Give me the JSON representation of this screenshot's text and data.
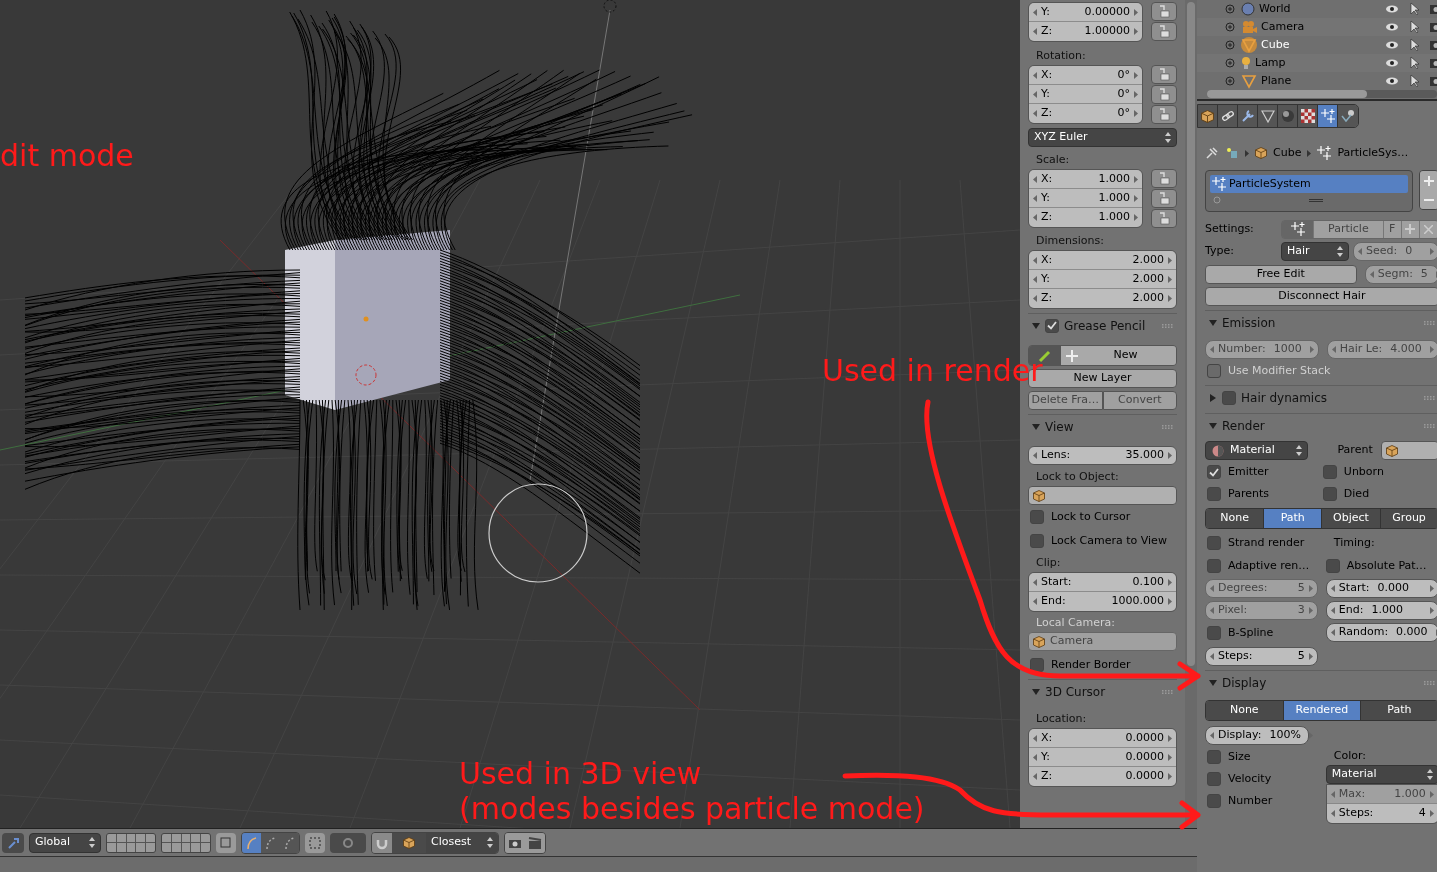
{
  "viewport": {
    "edit_mode_note": "dit mode",
    "render_note": "Used in render",
    "view_note": [
      "Used in 3D view",
      "(modes besides particle mode)"
    ]
  },
  "n_panel": {
    "location": [
      {
        "label": "Y:",
        "value": "0.00000"
      },
      {
        "label": "Z:",
        "value": "1.00000"
      }
    ],
    "rotation": {
      "label": "Rotation:",
      "fields": [
        {
          "label": "X:",
          "value": "0°"
        },
        {
          "label": "Y:",
          "value": "0°"
        },
        {
          "label": "Z:",
          "value": "0°"
        }
      ],
      "mode": "XYZ Euler"
    },
    "scale": {
      "label": "Scale:",
      "fields": [
        {
          "label": "X:",
          "value": "1.000"
        },
        {
          "label": "Y:",
          "value": "1.000"
        },
        {
          "label": "Z:",
          "value": "1.000"
        }
      ]
    },
    "dimensions": {
      "label": "Dimensions:",
      "fields": [
        {
          "label": "X:",
          "value": "2.000"
        },
        {
          "label": "Y:",
          "value": "2.000"
        },
        {
          "label": "Z:",
          "value": "2.000"
        }
      ]
    },
    "grease_pencil": {
      "title": "Grease Pencil",
      "expanded": true,
      "enabled": true,
      "new": "New",
      "new_layer": "New Layer",
      "delete_frame": "Delete Fra…",
      "convert": "Convert"
    },
    "view": {
      "title": "View",
      "expanded": true,
      "lens": {
        "label": "Lens:",
        "value": "35.000"
      },
      "lock_label": "Lock to Object:",
      "locks": [
        {
          "label": "Lock to Cursor",
          "checked": false
        },
        {
          "label": "Lock Camera to View",
          "checked": false
        }
      ],
      "clip_label": "Clip:",
      "clip": [
        {
          "label": "Start:",
          "value": "0.100"
        },
        {
          "label": "End:",
          "value": "1000.000"
        }
      ],
      "local_camera_label": "Local Camera:",
      "local_camera": "Camera",
      "render_border": {
        "label": "Render Border",
        "checked": false
      }
    },
    "cursor": {
      "title": "3D Cursor",
      "expanded": true,
      "location_label": "Location:",
      "fields": [
        {
          "label": "X:",
          "value": "0.0000"
        },
        {
          "label": "Y:",
          "value": "0.0000"
        },
        {
          "label": "Z:",
          "value": "0.0000"
        }
      ]
    }
  },
  "toolbar": {
    "orientation": "Global",
    "edit_modes": [
      {
        "selected": true
      },
      {
        "selected": false
      },
      {
        "selected": false
      }
    ],
    "snap_target": "Closest"
  },
  "outliner": {
    "items": [
      {
        "name": "World",
        "kind": "world",
        "selected": false
      },
      {
        "name": "Camera",
        "kind": "camera",
        "selected": false
      },
      {
        "name": "Cube",
        "kind": "mesh",
        "selected": true
      },
      {
        "name": "Lamp",
        "kind": "lamp",
        "selected": false
      },
      {
        "name": "Plane",
        "kind": "mesh",
        "selected": false
      }
    ]
  },
  "properties": {
    "tabs": [
      {
        "kind": "object",
        "selected": false
      },
      {
        "kind": "constraints",
        "selected": false
      },
      {
        "kind": "modifiers",
        "selected": false
      },
      {
        "kind": "data",
        "selected": false
      },
      {
        "kind": "material",
        "selected": false
      },
      {
        "kind": "texture",
        "selected": false
      },
      {
        "kind": "particles",
        "selected": true
      },
      {
        "kind": "physics",
        "selected": false
      }
    ],
    "breadcrumb": [
      "Cube",
      "ParticleSys…"
    ],
    "systems": [
      {
        "name": "ParticleSystem",
        "selected": true
      }
    ],
    "settings_label": "Settings:",
    "settings_name": "Particle",
    "fake_user": "F",
    "type_label": "Type:",
    "type": "Hair",
    "seed": {
      "label": "Seed:",
      "value": "0",
      "disabled": true
    },
    "free_edit": "Free Edit",
    "segments": {
      "label": "Segm:",
      "value": "5",
      "disabled": true
    },
    "disconnect": "Disconnect Hair",
    "emission": {
      "title": "Emission",
      "expanded": true,
      "number": {
        "label": "Number:",
        "value": "1000",
        "disabled": true
      },
      "hair_length": {
        "label": "Hair Le:",
        "value": "4.000",
        "disabled": true
      },
      "use_modifier_stack": {
        "label": "Use Modifier Stack",
        "checked": false,
        "disabled": true
      }
    },
    "hair_dynamics": {
      "title": "Hair dynamics",
      "expanded": false,
      "enabled": false
    },
    "render": {
      "title": "Render",
      "expanded": true,
      "material": "Material",
      "parent_label": "Parent",
      "checks": [
        {
          "label": "Emitter",
          "checked": true
        },
        {
          "label": "Unborn",
          "checked": false
        },
        {
          "label": "Parents",
          "checked": false
        },
        {
          "label": "Died",
          "checked": false
        }
      ],
      "modes": [
        {
          "label": "None",
          "selected": false
        },
        {
          "label": "Path",
          "selected": true
        },
        {
          "label": "Object",
          "selected": false
        },
        {
          "label": "Group",
          "selected": false
        }
      ],
      "strand_render": {
        "label": "Strand render",
        "checked": false
      },
      "adaptive": {
        "label": "Adaptive ren…",
        "checked": false
      },
      "timing_label": "Timing:",
      "absolute": {
        "label": "Absolute Pat…",
        "checked": false
      },
      "degrees": {
        "label": "Degrees:",
        "value": "5",
        "disabled": true
      },
      "pixel": {
        "label": "Pixel:",
        "value": "3",
        "disabled": true
      },
      "timing": [
        {
          "label": "Start:",
          "value": "0.000"
        },
        {
          "label": "End:",
          "value": "1.000"
        },
        {
          "label": "Random:",
          "value": "0.000"
        }
      ],
      "bspline": {
        "label": "B-Spline",
        "checked": false
      },
      "steps": {
        "label": "Steps:",
        "value": "5",
        "disabled": false
      }
    },
    "display": {
      "title": "Display",
      "expanded": true,
      "modes": [
        {
          "label": "None",
          "selected": false
        },
        {
          "label": "Rendered",
          "selected": true
        },
        {
          "label": "Path",
          "selected": false
        }
      ],
      "display": {
        "label": "Display:",
        "value": "100%",
        "disabled": false
      },
      "checks": [
        {
          "label": "Size",
          "checked": false
        },
        {
          "label": "Velocity",
          "checked": false
        },
        {
          "label": "Number",
          "checked": false
        }
      ],
      "color_label": "Color:",
      "color_mode": "Material",
      "max": {
        "label": "Max:",
        "value": "1.000",
        "disabled": true
      },
      "steps": {
        "label": "Steps:",
        "value": "4",
        "disabled": false
      }
    }
  }
}
